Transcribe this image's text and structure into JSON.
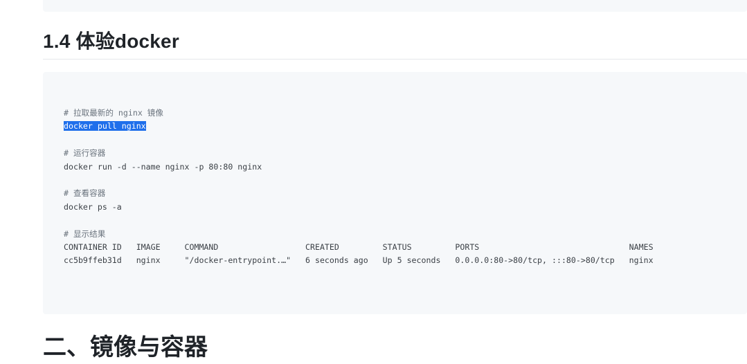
{
  "section_heading": "1.4 体验docker",
  "code": {
    "comment_pull": "# 拉取最新的 nginx 镜像",
    "cmd_pull": "docker pull nginx",
    "comment_run": "# 运行容器",
    "cmd_run": "docker run -d --name nginx -p 80:80 nginx",
    "comment_ps": "# 查看容器",
    "cmd_ps": "docker ps -a",
    "comment_result": "# 显示结果",
    "table_header": "CONTAINER ID   IMAGE     COMMAND                  CREATED         STATUS         PORTS                               NAMES",
    "table_row": "cc5b9ffeb31d   nginx     \"/docker-entrypoint.…\"   6 seconds ago   Up 5 seconds   0.0.0.0:80->80/tcp, :::80->80/tcp   nginx"
  },
  "next_heading": "二、镜像与容器"
}
